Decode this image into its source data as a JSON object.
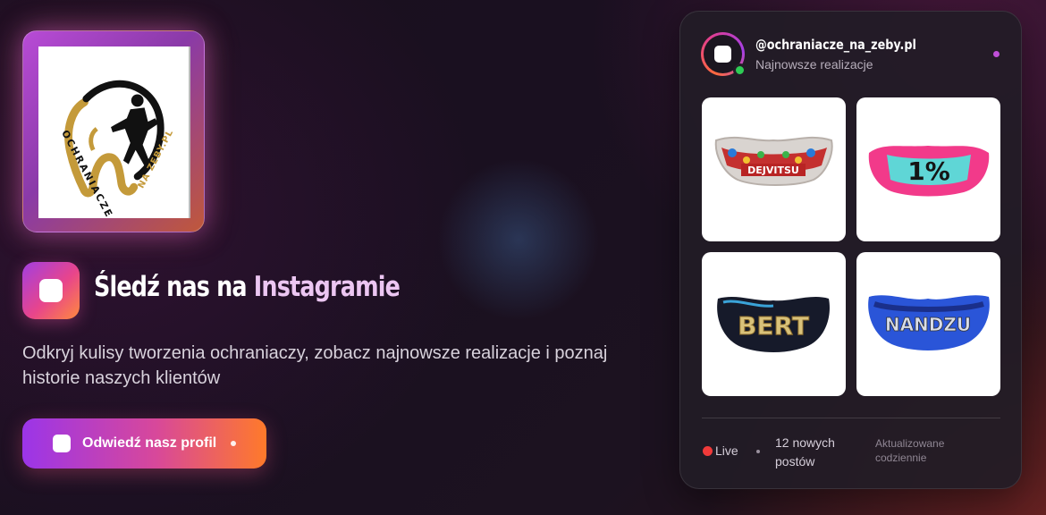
{
  "logo": {
    "text_left": "OCHRANIACZE",
    "text_right": "NA ZEBY.PL"
  },
  "section": {
    "title_part1": "Śledź nas na",
    "title_part2": "Instagramie",
    "description": "Odkryj kulisy tworzenia ochraniaczy, zobacz najnowsze realizacje i poznaj historie naszych klientów",
    "cta_label": "Odwiedź nasz profil"
  },
  "card": {
    "handle": "@ochraniacze_na_zeby.pl",
    "subtitle": "Najnowsze realizacje",
    "posts": [
      {
        "text": "DEJVITSU",
        "icon": "mouthguard-image"
      },
      {
        "text": "1%",
        "icon": "mouthguard-image"
      },
      {
        "text": "BERT",
        "icon": "mouthguard-image"
      },
      {
        "text": "NANDZU",
        "icon": "mouthguard-image"
      }
    ],
    "status_live": "Live",
    "posts_count": "12 nowych postów",
    "updated": "Aktualizowane codziennie"
  },
  "colors": {
    "gradient_start": "#9b35e8",
    "gradient_mid": "#d8489a",
    "gradient_end": "#ff7a2a",
    "live": "#f03a3a",
    "online": "#2ecc55"
  }
}
